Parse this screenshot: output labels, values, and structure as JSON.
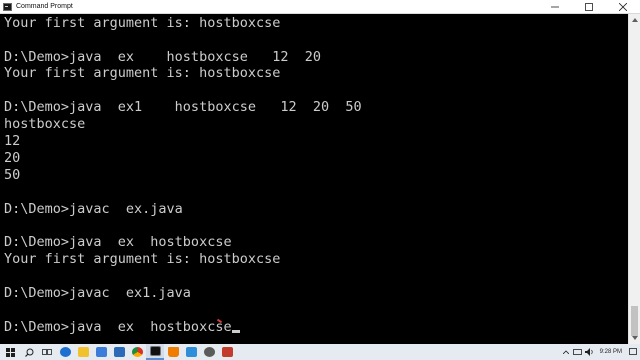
{
  "window": {
    "title": "Command Prompt",
    "minimize_glyph": "minimize-icon",
    "maximize_glyph": "maximize-icon",
    "close_glyph": "close-icon"
  },
  "console": {
    "lines": [
      "Your first argument is: hostboxcse",
      "",
      "D:\\Demo>java  ex    hostboxcse   12  20",
      "Your first argument is: hostboxcse",
      "",
      "D:\\Demo>java  ex1    hostboxcse   12  20  50",
      "hostboxcse",
      "12",
      "20",
      "50",
      "",
      "D:\\Demo>javac  ex.java",
      "",
      "D:\\Demo>java  ex  hostboxcse",
      "Your first argument is: hostboxcse",
      "",
      "D:\\Demo>javac  ex1.java",
      "",
      "D:\\Demo>java  ex  hostboxcse"
    ]
  },
  "taskbar": {
    "clock_time": "9:28 PM",
    "clock_date": "",
    "icons": [
      "windows-start-icon",
      "search-icon",
      "task-view-icon",
      "edge-icon",
      "file-explorer-icon",
      "store-icon",
      "mail-icon",
      "chrome-icon",
      "command-prompt-icon",
      "vlc-icon",
      "photos-icon",
      "settings-icon",
      "app-icon"
    ],
    "colors": {
      "background": "#e6ebf1",
      "console_bg": "#000000",
      "console_text": "#cccccc"
    }
  }
}
